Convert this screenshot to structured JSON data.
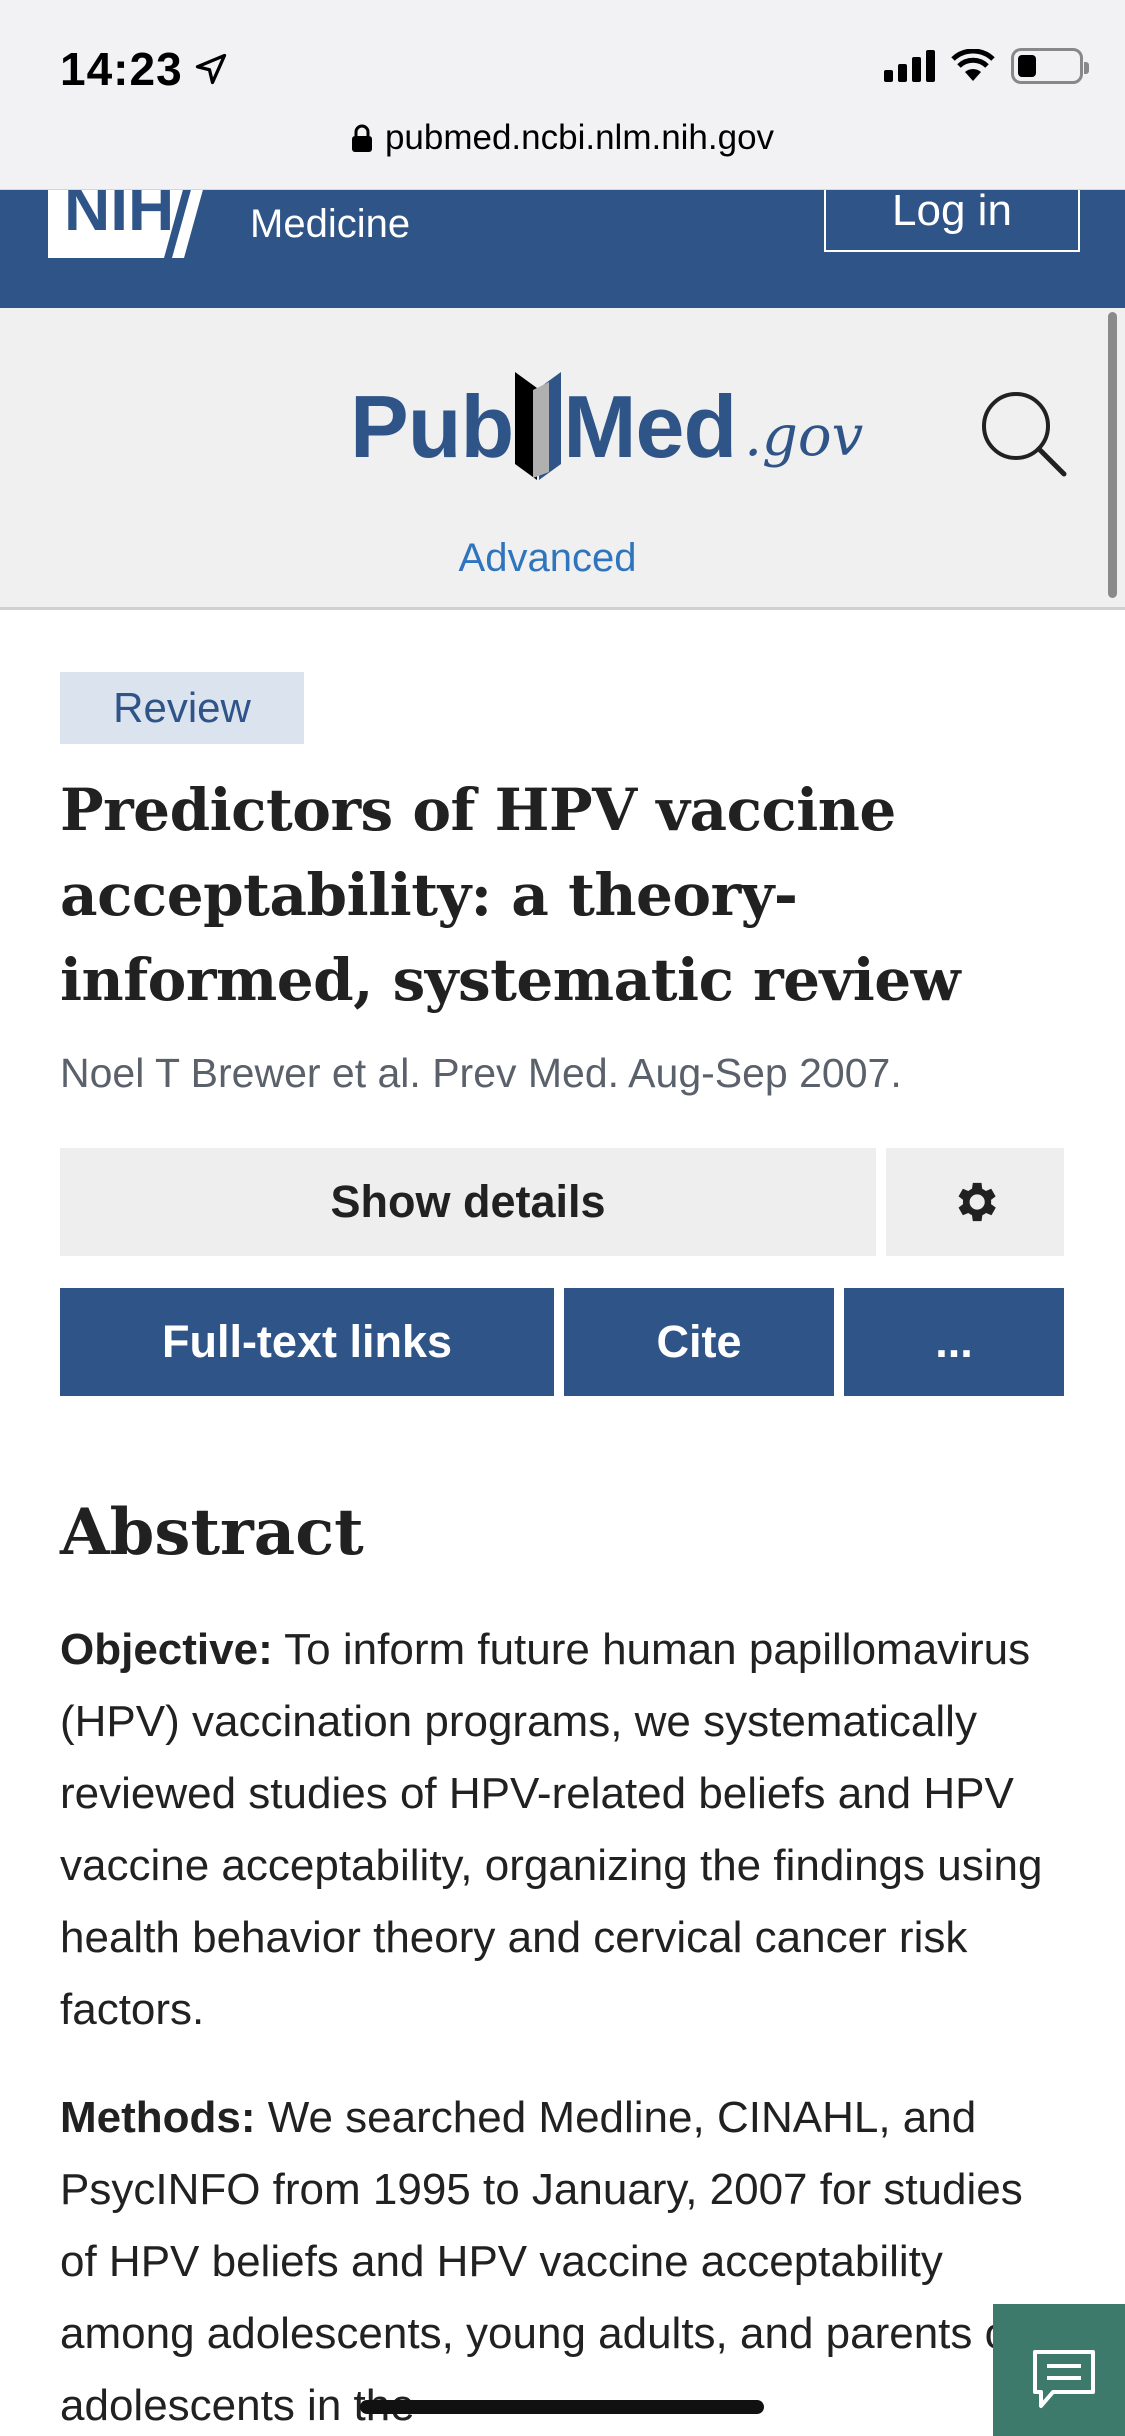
{
  "status_bar": {
    "time": "14:23",
    "url": "pubmed.ncbi.nlm.nih.gov"
  },
  "nih_banner": {
    "logo_text": "NIH",
    "org_text": "Medicine",
    "login_label": "Log in"
  },
  "pubmed_header": {
    "logo_pub": "Pub",
    "logo_med": "Med",
    "logo_gov": ".gov",
    "advanced_label": "Advanced"
  },
  "article": {
    "badge": "Review",
    "title": "Predictors of HPV vaccine acceptability: a theory-informed, systematic review",
    "citation": "Noel T Brewer et al. Prev Med. Aug-Sep 2007."
  },
  "actions": {
    "show_details": "Show details",
    "full_text_links": "Full-text links",
    "cite": "Cite",
    "more": "..."
  },
  "abstract": {
    "heading": "Abstract",
    "objective_label": "Objective:",
    "objective_text": " To inform future human papillomavirus (HPV) vaccination programs, we systematically reviewed studies of HPV-related beliefs and HPV vaccine acceptability, organizing the findings using health behavior theory and cervical cancer risk factors.",
    "methods_label": "Methods:",
    "methods_text": " We searched Medline, CINAHL, and PsycINFO from 1995 to January, 2007 for studies of HPV beliefs and HPV vaccine acceptability among adolescents, young adults, and parents of adolescents in the"
  },
  "colors": {
    "nih_blue": "#2e5488",
    "link_blue": "#2e75bd",
    "chat_green": "#3d7a6b"
  }
}
